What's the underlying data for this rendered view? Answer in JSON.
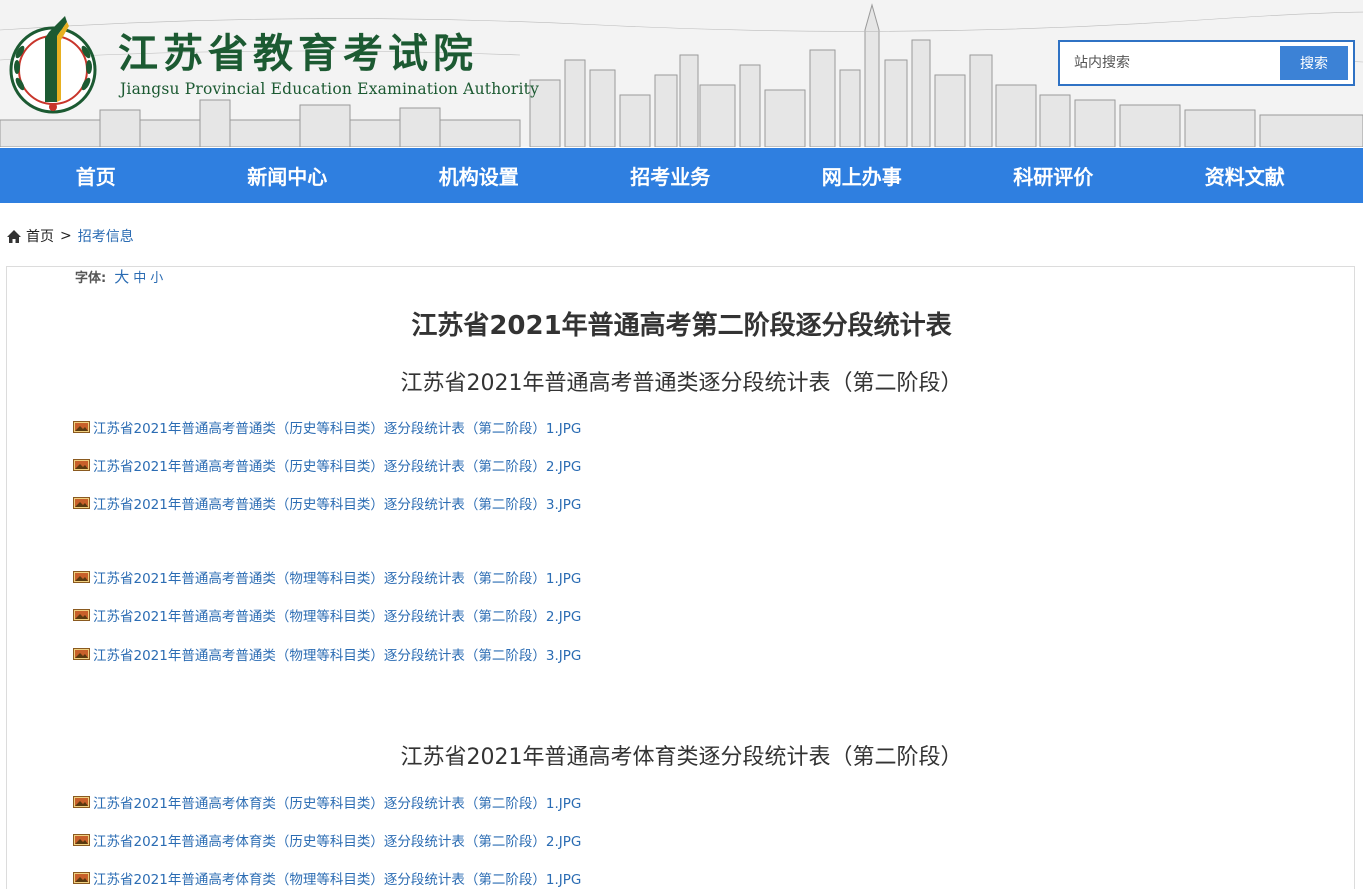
{
  "header": {
    "logo_cn": "江苏省教育考试院",
    "logo_en": "Jiangsu Provincial Education Examination Authority",
    "search_placeholder": "站内搜索",
    "search_button": "搜索"
  },
  "nav": {
    "items": [
      "首页",
      "新闻中心",
      "机构设置",
      "招考业务",
      "网上办事",
      "科研评价",
      "资料文献"
    ]
  },
  "breadcrumb": {
    "home": "首页",
    "separator": ">",
    "current": "招考信息"
  },
  "font_size": {
    "label": "字体:",
    "large": "大",
    "medium": "中",
    "small": "小"
  },
  "article": {
    "title": "江苏省2021年普通高考第二阶段逐分段统计表",
    "sections": [
      {
        "title": "江苏省2021年普通高考普通类逐分段统计表（第二阶段）",
        "groups": [
          [
            "江苏省2021年普通高考普通类（历史等科目类）逐分段统计表（第二阶段）1.JPG",
            "江苏省2021年普通高考普通类（历史等科目类）逐分段统计表（第二阶段）2.JPG",
            "江苏省2021年普通高考普通类（历史等科目类）逐分段统计表（第二阶段）3.JPG"
          ],
          [
            "江苏省2021年普通高考普通类（物理等科目类）逐分段统计表（第二阶段）1.JPG",
            "江苏省2021年普通高考普通类（物理等科目类）逐分段统计表（第二阶段）2.JPG",
            "江苏省2021年普通高考普通类（物理等科目类）逐分段统计表（第二阶段）3.JPG"
          ]
        ]
      },
      {
        "title": "江苏省2021年普通高考体育类逐分段统计表（第二阶段）",
        "groups": [
          [
            "江苏省2021年普通高考体育类（历史等科目类）逐分段统计表（第二阶段）1.JPG",
            "江苏省2021年普通高考体育类（历史等科目类）逐分段统计表（第二阶段）2.JPG",
            "江苏省2021年普通高考体育类（物理等科目类）逐分段统计表（第二阶段）1.JPG"
          ]
        ]
      }
    ]
  },
  "colors": {
    "nav_bg": "#2f7fe0",
    "logo_green": "#1c5a32",
    "link_blue": "#2b6cb3",
    "search_button": "#3c82d6"
  }
}
